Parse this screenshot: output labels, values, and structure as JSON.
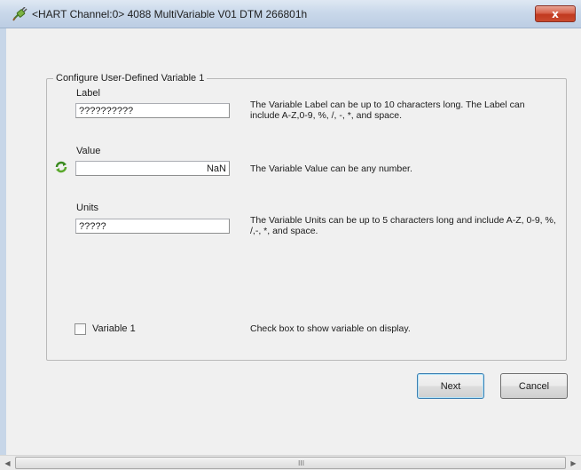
{
  "window": {
    "title": "<HART Channel:0> 4088 MultiVariable V01 DTM 266801h",
    "close_label": "x"
  },
  "group": {
    "legend": "Configure User-Defined Variable 1"
  },
  "label_field": {
    "label": "Label",
    "value": "??????????",
    "description": "The Variable Label can be up to 10 characters long. The Label can include A-Z,0-9, %, /, -, *, and space."
  },
  "value_field": {
    "label": "Value",
    "value": "NaN",
    "description": "The Variable Value can be any number."
  },
  "units_field": {
    "label": "Units",
    "value": "?????",
    "description": "The Variable Units can be up to 5 characters long and include A-Z, 0-9, %, /,-, *, and space."
  },
  "checkbox": {
    "label": "Variable 1",
    "checked": false,
    "description": "Check box to show variable on display."
  },
  "buttons": {
    "next": "Next",
    "cancel": "Cancel"
  },
  "scrollbar": {
    "left_arrow": "◀",
    "right_arrow": "▶",
    "grip": "III"
  },
  "colors": {
    "titlebar": "#c9d8ea",
    "close_button": "#c94a2e",
    "background": "#f0f0f0",
    "refresh_icon": "#3a8a1f"
  },
  "icons": {
    "app": "app-plug-icon",
    "refresh": "refresh-icon"
  }
}
